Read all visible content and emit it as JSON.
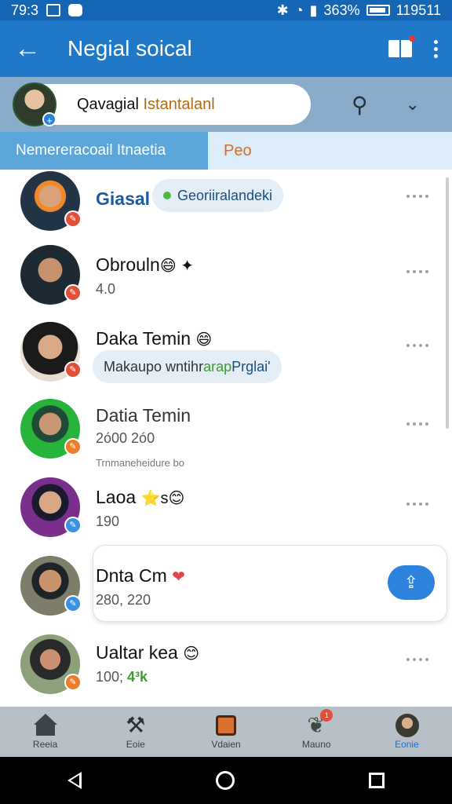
{
  "status_bar": {
    "time": "79:3",
    "right_text": "363%",
    "clock_right": "119511"
  },
  "app_bar": {
    "title": "Negial soical"
  },
  "profile": {
    "name_main": "Qavagial ",
    "name_accent": "Istantalanl"
  },
  "tabs": [
    {
      "label": "Nemereracoail Itnaetia"
    },
    {
      "label": "Peo"
    }
  ],
  "contacts": [
    {
      "name": "Giasal",
      "chip_text": "Georiiralandeki",
      "chip_dot": true
    },
    {
      "name": "Obrouln",
      "emoji": "😄 ✦",
      "sub": "4.0"
    },
    {
      "name": "Daka Temin",
      "emoji": "😄",
      "chip_text_a": "Makaupo wntihr",
      "chip_text_b": "arap",
      "chip_text_c": " Prglai'"
    },
    {
      "name": "Datia Temin",
      "sub": "2ó00 2ó0",
      "tiny": "Trnmaneheidure bo"
    },
    {
      "name": "Laoa",
      "emoji": "⭐s😊",
      "sub": "190"
    },
    {
      "name": "Dnta Cm",
      "emoji": "❤",
      "sub": "280, 220"
    },
    {
      "name": "Ualtar kea",
      "emoji": "😊",
      "sub_a": "100; ",
      "sub_b": "4³k"
    }
  ],
  "bottom_nav": [
    {
      "label": "Reeia",
      "icon": "home-icon"
    },
    {
      "label": "Eoie",
      "icon": "tools-icon"
    },
    {
      "label": "Vdaien",
      "icon": "grid-icon"
    },
    {
      "label": "Mauno",
      "icon": "leaf-icon",
      "badge": "1"
    },
    {
      "label": "Eonie",
      "icon": "profile-icon",
      "active": true
    }
  ],
  "colors": {
    "app_bar": "#1f78c8",
    "tab_active": "#5aa6da",
    "fab": "#2c82dc",
    "accent_orange": "#d96a2c"
  }
}
